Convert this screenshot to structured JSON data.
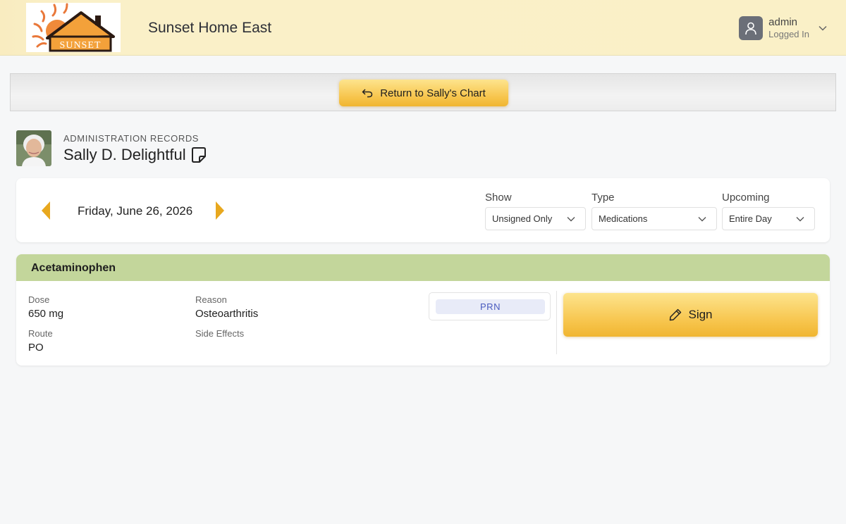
{
  "header": {
    "logo_text": "SUNSET",
    "facility_name": "Sunset Home East",
    "user": {
      "name": "admin",
      "status": "Logged In"
    }
  },
  "return_bar": {
    "label": "Return to Sally's Chart"
  },
  "patient": {
    "section_label": "ADMINISTRATION RECORDS",
    "name": "Sally D. Delightful"
  },
  "filters": {
    "date": "Friday, June 26, 2026",
    "show": {
      "label": "Show",
      "value": "Unsigned Only"
    },
    "type": {
      "label": "Type",
      "value": "Medications"
    },
    "upcoming": {
      "label": "Upcoming",
      "value": "Entire Day"
    }
  },
  "medication": {
    "name": "Acetaminophen",
    "dose_label": "Dose",
    "dose": "650 mg",
    "route_label": "Route",
    "route": "PO",
    "reason_label": "Reason",
    "reason": "Osteoarthritis",
    "side_effects_label": "Side Effects",
    "side_effects": "",
    "badge": "PRN",
    "sign_label": "Sign"
  },
  "colors": {
    "header_bg": "#faf0c7",
    "accent_gold": "#f7c54d",
    "med_header": "#c3d69b",
    "prn_text": "#4a5bbf",
    "date_arrow": "#e8a81e"
  }
}
